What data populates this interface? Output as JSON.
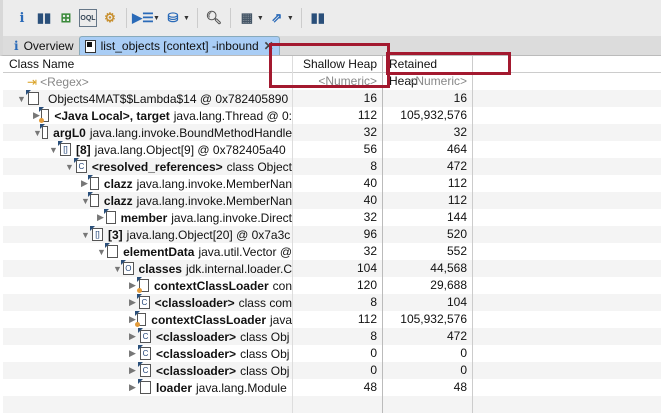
{
  "toolbar": {
    "icons": [
      "info-icon",
      "histogram-icon",
      "dominator-tree-icon",
      "oql-icon",
      "thread-gear-icon",
      "query-browser-icon",
      "heap-dump-overview-icon",
      "search-icon",
      "calculator-icon",
      "export-icon",
      "leak-suspects-icon"
    ]
  },
  "tabs": [
    {
      "label": "Overview",
      "icon": "info-icon"
    },
    {
      "label": "list_objects [context] -inbound",
      "icon": "document-icon",
      "active": true
    }
  ],
  "columns": {
    "name": "Class Name",
    "shallow": "Shallow Heap",
    "retained": "Retained Heap"
  },
  "filter": {
    "name": "<Regex>",
    "shallow": "<Numeric>",
    "retained": "<Numeric>"
  },
  "highlight_color": "#a3192f",
  "rows": [
    {
      "depth": 0,
      "exp": "open",
      "icon": "object",
      "bold": "",
      "text": "Objects4MAT$$Lambda$14 @ 0x782405890",
      "shallow": "16",
      "retained": "16"
    },
    {
      "depth": 1,
      "exp": "closed",
      "icon": "dot",
      "bold": "<Java Local>, target",
      "text": "java.lang.Thread @ 0:",
      "shallow": "112",
      "retained": "105,932,576"
    },
    {
      "depth": 1,
      "exp": "open",
      "icon": "obj",
      "bold": "argL0",
      "text": "java.lang.invoke.BoundMethodHandle",
      "shallow": "32",
      "retained": "32"
    },
    {
      "depth": 2,
      "exp": "open",
      "icon": "arr",
      "bold": "[8]",
      "text": "java.lang.Object[9] @ 0x782405a40",
      "shallow": "56",
      "retained": "464"
    },
    {
      "depth": 3,
      "exp": "open",
      "icon": "cls",
      "bold": "<resolved_references>",
      "text": "class Object",
      "shallow": "8",
      "retained": "472"
    },
    {
      "depth": 4,
      "exp": "closed",
      "icon": "obj",
      "bold": "clazz",
      "text": "java.lang.invoke.MemberNan",
      "shallow": "40",
      "retained": "112"
    },
    {
      "depth": 4,
      "exp": "open",
      "icon": "obj",
      "bold": "clazz",
      "text": "java.lang.invoke.MemberNan",
      "shallow": "40",
      "retained": "112"
    },
    {
      "depth": 5,
      "exp": "closed",
      "icon": "obj",
      "bold": "member",
      "text": "java.lang.invoke.Direct",
      "shallow": "32",
      "retained": "144"
    },
    {
      "depth": 4,
      "exp": "open",
      "icon": "arr",
      "bold": "[3]",
      "text": "java.lang.Object[20] @ 0x7a3c",
      "shallow": "96",
      "retained": "520"
    },
    {
      "depth": 5,
      "exp": "open",
      "icon": "obj",
      "bold": "elementData",
      "text": "java.util.Vector @",
      "shallow": "32",
      "retained": "552"
    },
    {
      "depth": 6,
      "exp": "open",
      "icon": "o",
      "bold": "classes",
      "text": "jdk.internal.loader.C",
      "shallow": "104",
      "retained": "44,568"
    },
    {
      "depth": 7,
      "exp": "closed",
      "icon": "dot",
      "bold": "contextClassLoader",
      "text": "con",
      "shallow": "120",
      "retained": "29,688"
    },
    {
      "depth": 7,
      "exp": "closed",
      "icon": "cls",
      "bold": "<classloader>",
      "text": "class com",
      "shallow": "8",
      "retained": "104"
    },
    {
      "depth": 7,
      "exp": "closed",
      "icon": "dot",
      "bold": "contextClassLoader",
      "text": "java",
      "shallow": "112",
      "retained": "105,932,576"
    },
    {
      "depth": 7,
      "exp": "closed",
      "icon": "cls",
      "bold": "<classloader>",
      "text": "class Obj",
      "shallow": "8",
      "retained": "472"
    },
    {
      "depth": 7,
      "exp": "closed",
      "icon": "cls",
      "bold": "<classloader>",
      "text": "class Obj",
      "shallow": "0",
      "retained": "0"
    },
    {
      "depth": 7,
      "exp": "closed",
      "icon": "cls",
      "bold": "<classloader>",
      "text": "class Obj",
      "shallow": "0",
      "retained": "0"
    },
    {
      "depth": 7,
      "exp": "closed",
      "icon": "obj",
      "bold": "loader",
      "text": "java.lang.Module",
      "shallow": "48",
      "retained": "48"
    }
  ]
}
